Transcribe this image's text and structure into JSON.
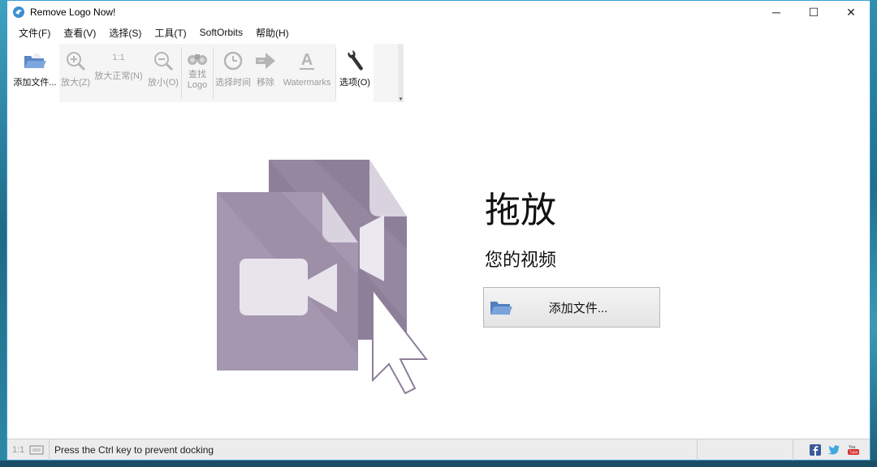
{
  "window": {
    "title": "Remove Logo Now!",
    "controls": {
      "minimize": "─",
      "maximize": "☐",
      "close": "✕"
    }
  },
  "menu": [
    "文件(F)",
    "查看(V)",
    "选择(S)",
    "工具(T)",
    "SoftOrbits",
    "帮助(H)"
  ],
  "toolbar": {
    "add_file": "添加文件...",
    "zoom_in": "放大(Z)",
    "zoom_reset_icon": "1:1",
    "zoom_reset": "放大正常(N)",
    "zoom_out": "放小(O)",
    "find_logo_1": "查找",
    "find_logo_2": "Logo",
    "select_time": "选择时间",
    "remove": "移除",
    "watermarks": "Watermarks",
    "options": "选项(O)",
    "overflow": "▾"
  },
  "main": {
    "drop_title": "拖放",
    "drop_subtitle": "您的视频",
    "add_file_button": "添加文件..."
  },
  "status": {
    "zoom_label": "1:1",
    "message": "Press the Ctrl key to prevent docking"
  },
  "colors": {
    "accent_border": "#3d9bd4",
    "file_icon_dark": "#8e7f99",
    "file_icon_light": "#a597b0",
    "toolbar_bg": "#f5f5f5"
  },
  "icons": [
    "app-logo-icon",
    "folder-open-icon",
    "zoom-in-icon",
    "zoom-out-icon",
    "binoculars-icon",
    "clock-icon",
    "arrow-right-icon",
    "text-a-icon",
    "wrench-icon",
    "facebook-icon",
    "twitter-icon",
    "youtube-icon"
  ]
}
